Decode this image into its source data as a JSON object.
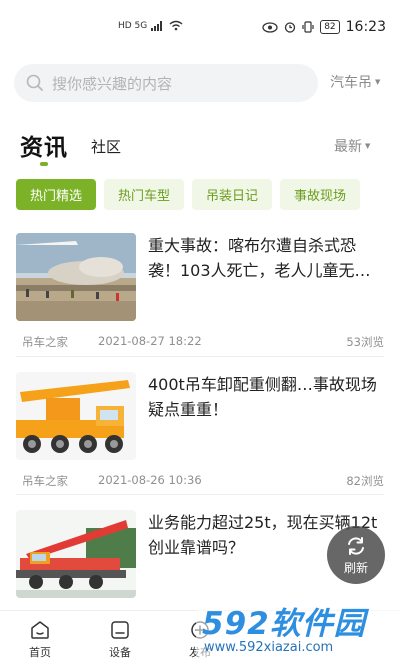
{
  "status_bar": {
    "network_text": "HD 5G",
    "battery": "82",
    "time": "16:23"
  },
  "search": {
    "placeholder": "搜你感兴趣的内容",
    "scope": "汽车吊"
  },
  "main_tabs": {
    "info": "资讯",
    "community": "社区",
    "sort": "最新"
  },
  "chips": [
    {
      "label": "热门精选",
      "active": true
    },
    {
      "label": "热门车型",
      "active": false
    },
    {
      "label": "吊装日记",
      "active": false
    },
    {
      "label": "事故现场",
      "active": false
    }
  ],
  "articles": [
    {
      "title": "重大事故：喀布尔遭自杀式恐袭！103人死亡，老人儿童无…",
      "source": "吊车之家",
      "date": "2021-08-27 18:22",
      "views": "53浏览"
    },
    {
      "title": "400t吊车卸配重侧翻…事故现场疑点重重！",
      "source": "吊车之家",
      "date": "2021-08-26 10:36",
      "views": "82浏览"
    },
    {
      "title": "业务能力超过25t，现在买辆12t创业靠谱吗？",
      "source": "",
      "date": "",
      "views": ""
    }
  ],
  "refresh": {
    "label": "刷新"
  },
  "bottom_nav": [
    {
      "label": "首页",
      "icon": "home-icon"
    },
    {
      "label": "设备",
      "icon": "device-icon"
    },
    {
      "label": "发布",
      "icon": "publish-icon"
    }
  ],
  "watermark": {
    "logo": "592软件园",
    "url": "www.592xiazai.com"
  },
  "colors": {
    "accent": "#7cb227",
    "chip_bg": "#f1f7e6",
    "chip_text": "#6b9d1f"
  }
}
